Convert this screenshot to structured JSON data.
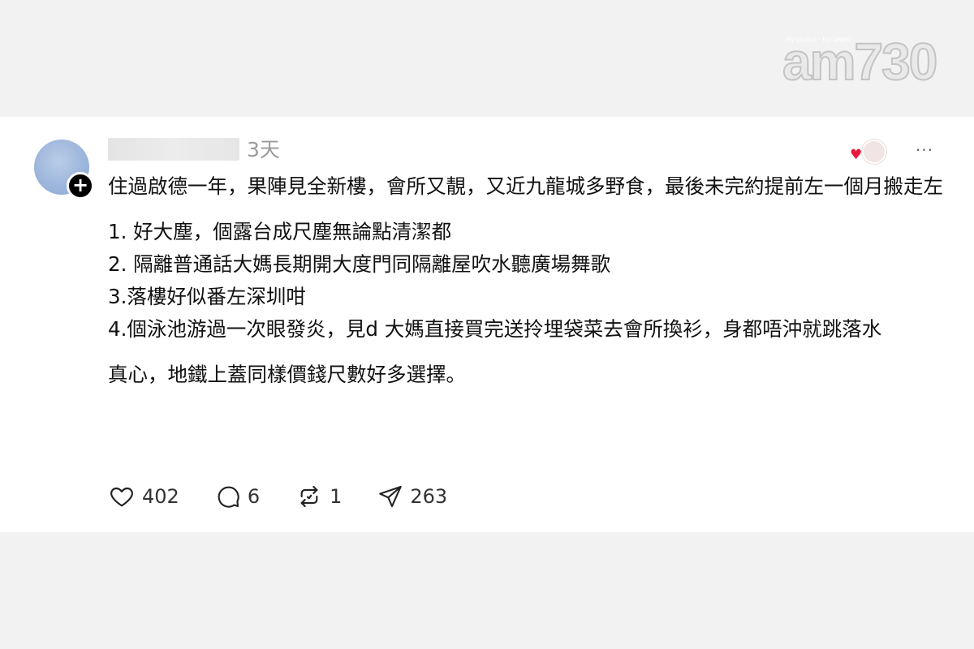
{
  "header": {
    "logo_tagline": "my choice · my paper",
    "logo_text": "am730"
  },
  "post": {
    "time": "3天",
    "more_label": "···",
    "paragraphs": [
      "住過啟德一年，果陣見全新樓，會所又靚，又近九龍城多野食，最後未完約提前左一個月搬走左",
      "1. 好大塵，個露台成尺塵無論點清潔都",
      "2. 隔離普通話大媽長期開大度門同隔離屋吹水聽廣場舞歌",
      "3.落樓好似番左深圳咁",
      "4.個泳池游過一次眼發炎，見d 大媽直接買完送拎埋袋菜去會所換衫，身都唔沖就跳落水",
      "真心，地鐵上蓋同樣價錢尺數好多選擇。"
    ],
    "actions": {
      "likes": "402",
      "comments": "6",
      "reposts": "1",
      "shares": "263"
    },
    "icons": {
      "like": "heart-icon",
      "comment": "comment-bubble-icon",
      "repost": "repost-icon",
      "share": "send-icon",
      "reaction": "heart-reaction-icon",
      "follow": "plus-icon"
    },
    "colors": {
      "heart": "#e8193c",
      "avatar": "#9db6db",
      "time": "#9a9a9a"
    }
  }
}
